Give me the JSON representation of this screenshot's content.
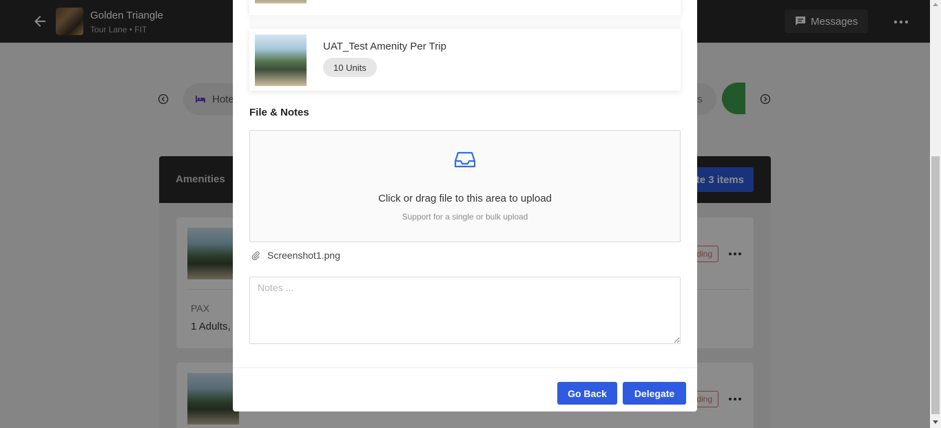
{
  "header": {
    "trip_title": "Golden Triangle",
    "trip_subtitle": "Tour Lane • FIT",
    "messages_label": "Messages"
  },
  "category_nav": {
    "hotel_label": "Hote",
    "right_label": "ts"
  },
  "panel": {
    "title": "Amenities",
    "delegate_items_label": "te 3 items",
    "cards": [
      {
        "status": "ding",
        "pax_label": "PAX",
        "pax_value": "1 Adults,"
      },
      {
        "status": "ding"
      }
    ]
  },
  "modal": {
    "amenity": {
      "title": "UAT_Test Amenity Per Trip",
      "units": "10 Units"
    },
    "files_section_title": "File & Notes",
    "dropzone": {
      "title": "Click or drag file to this area to upload",
      "hint": "Support for a single or bulk upload"
    },
    "attached_file": "Screenshot1.png",
    "notes_placeholder": "Notes ...",
    "go_back_label": "Go Back",
    "delegate_label": "Delegate"
  },
  "colors": {
    "primary": "#2f5be0",
    "topbar": "#2b2b2b",
    "basket_green": "#3fa34d",
    "pending_red": "#e26a6a"
  }
}
